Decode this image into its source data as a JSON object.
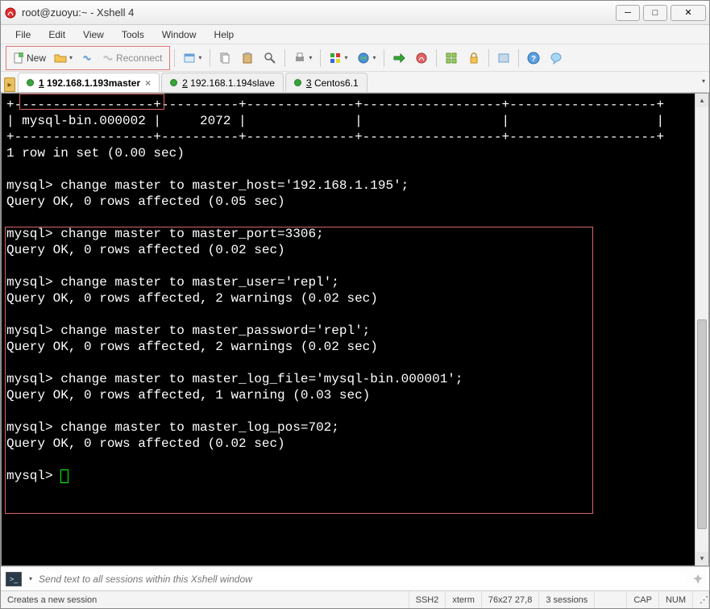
{
  "window": {
    "title": "root@zuoyu:~ - Xshell 4"
  },
  "menu": {
    "file": "File",
    "edit": "Edit",
    "view": "View",
    "tools": "Tools",
    "window": "Window",
    "help": "Help"
  },
  "toolbar": {
    "new_label": "New",
    "reconnect_label": "Reconnect"
  },
  "tabs": [
    {
      "num": "1",
      "label": "192.168.1.193master",
      "active": true
    },
    {
      "num": "2",
      "label": "192.168.1.194slave",
      "active": false
    },
    {
      "num": "3",
      "label": "Centos6.1",
      "active": false
    }
  ],
  "terminal": {
    "lines": [
      "+------------------+----------+--------------+------------------+-------------------+",
      "| mysql-bin.000002 |     2072 |              |                  |                   |",
      "+------------------+----------+--------------+------------------+-------------------+",
      "1 row in set (0.00 sec)",
      "",
      "mysql> change master to master_host='192.168.1.195';",
      "Query OK, 0 rows affected (0.05 sec)",
      "",
      "mysql> change master to master_port=3306;",
      "Query OK, 0 rows affected (0.02 sec)",
      "",
      "mysql> change master to master_user='repl';",
      "Query OK, 0 rows affected, 2 warnings (0.02 sec)",
      "",
      "mysql> change master to master_password='repl';",
      "Query OK, 0 rows affected, 2 warnings (0.02 sec)",
      "",
      "mysql> change master to master_log_file='mysql-bin.000001';",
      "Query OK, 0 rows affected, 1 warning (0.03 sec)",
      "",
      "mysql> change master to master_log_pos=702;",
      "Query OK, 0 rows affected (0.02 sec)",
      "",
      "mysql> "
    ]
  },
  "inputbar": {
    "placeholder": "Send text to all sessions within this Xshell window"
  },
  "status": {
    "hint": "Creates a new session",
    "proto": "SSH2",
    "term": "xterm",
    "size": "76x27",
    "cursor": "27,8",
    "sessions": "3 sessions",
    "cap": "CAP",
    "num": "NUM"
  }
}
